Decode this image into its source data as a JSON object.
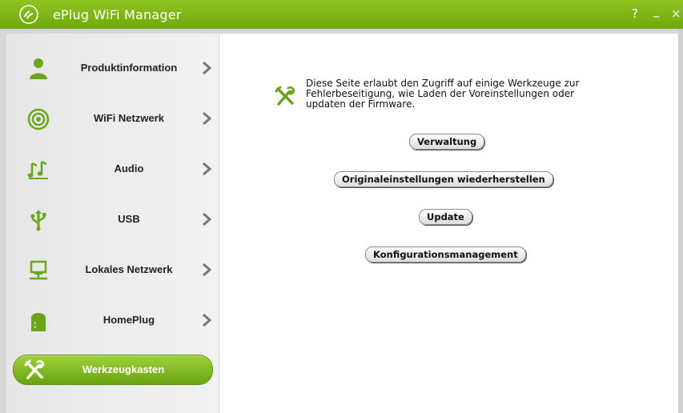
{
  "window": {
    "title": "ePlug WiFi Manager",
    "controls": {
      "help": "?",
      "minimize": "_",
      "close": "×"
    }
  },
  "colors": {
    "accent_green": "#7db61a",
    "sidebar_bg": "#eeeeee",
    "chevron": "#777777"
  },
  "sidebar": {
    "items": [
      {
        "label": "Produktinformation",
        "icon": "user-icon"
      },
      {
        "label": "WiFi Netzwerk",
        "icon": "wifi-icon"
      },
      {
        "label": "Audio",
        "icon": "music-note-icon"
      },
      {
        "label": "USB",
        "icon": "usb-icon"
      },
      {
        "label": "Lokales Netzwerk",
        "icon": "network-icon"
      },
      {
        "label": "HomePlug",
        "icon": "plug-icon"
      }
    ],
    "active_item": {
      "label": "Werkzeugkasten",
      "icon": "tools-icon"
    }
  },
  "main": {
    "description": "Diese Seite erlaubt den Zugriff auf einige Werkzeuge zur Fehlerbeseitigung, wie Laden der Voreinstellungen oder updaten der Firmware.",
    "description_lines": [
      "Diese Seite erlaubt den Zugriff auf einige Werkzeuge zur",
      "Fehlerbeseitigung, wie Laden der Voreinstellungen oder",
      "updaten der Firmware."
    ],
    "buttons": {
      "management": "Verwaltung",
      "factory_reset": "Originaleinstellungen wiederherstellen",
      "update": "Update",
      "config_management": "Konfigurationsmanagement"
    }
  }
}
